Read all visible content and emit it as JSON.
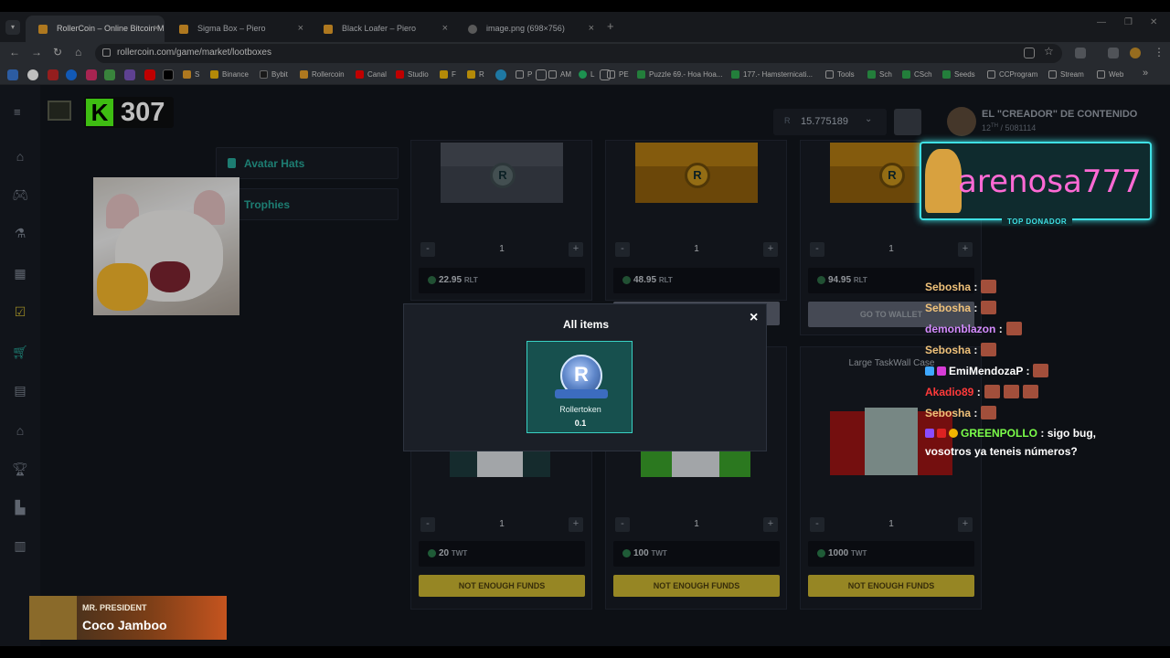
{
  "browser": {
    "tabs": [
      {
        "title": "RollerCoin – Online Bitcoin Mi",
        "active": true
      },
      {
        "title": "Sigma Box – Piero",
        "active": false
      },
      {
        "title": "Black Loafer – Piero",
        "active": false
      },
      {
        "title": "image.png (698×756)",
        "active": false
      }
    ],
    "url": "rollercoin.com/game/market/lootboxes",
    "bookmarks": [
      "S",
      "Binance",
      "Bybit",
      "Rollercoin",
      "Canal",
      "Studio",
      "F",
      "R",
      "P",
      "AM",
      "L",
      "PE",
      "Puzzle 69.- Hoa Hoa...",
      "177.- Hamsternicati...",
      "Tools",
      "Sch",
      "CSch",
      "Seeds",
      "CCProgram",
      "Stream",
      "Web"
    ]
  },
  "header": {
    "kick_count": "307",
    "balance_currency": "R",
    "balance": "15.775189",
    "username": "EL \"CREADOR\" DE CONTENIDO",
    "rank": "12",
    "rank_sup": "TH",
    "rank_total": "/ 5081114"
  },
  "side_menu": {
    "items": [
      "Avatar Hats",
      "Trophies"
    ]
  },
  "cards_top": [
    {
      "qty": "1",
      "price": "22.95",
      "unit": "RLT"
    },
    {
      "qty": "1",
      "price": "48.95",
      "unit": "RLT"
    },
    {
      "qty": "1",
      "price": "94.95",
      "unit": "RLT",
      "button": "GO TO WALLET"
    }
  ],
  "cards_bottom": [
    {
      "title": "",
      "qty": "1",
      "price": "20",
      "unit": "TWT",
      "button": "NOT ENOUGH FUNDS"
    },
    {
      "title": "",
      "qty": "1",
      "price": "100",
      "unit": "TWT",
      "button": "NOT ENOUGH FUNDS"
    },
    {
      "title": "Large TaskWall Case",
      "qty": "1",
      "price": "1000",
      "unit": "TWT",
      "button": "NOT ENOUGH FUNDS"
    }
  ],
  "modal": {
    "title": "All items",
    "close": "×",
    "item": {
      "name": "Rollertoken",
      "amount": "0.1",
      "symbol": "R"
    }
  },
  "donor": {
    "name": "arenosa777",
    "badge": "TOP DONADOR"
  },
  "chat": [
    {
      "user": "Sebosha",
      "color": "#f0c27a",
      "text": ":"
    },
    {
      "user": "Sebosha",
      "color": "#f0c27a",
      "text": ":"
    },
    {
      "user": "demonblazon",
      "color": "#d58cff",
      "text": ":"
    },
    {
      "user": "Sebosha",
      "color": "#f0c27a",
      "text": ":"
    },
    {
      "user": "EmiMendozaP",
      "color": "#ffffff",
      "text": ":"
    },
    {
      "user": "Akadio89",
      "color": "#ff3a3a",
      "text": ":"
    },
    {
      "user": "Sebosha",
      "color": "#f0c27a",
      "text": ":"
    },
    {
      "user": "GREENPOLLO",
      "color": "#7cff4a",
      "text": ": sigo bug,"
    },
    {
      "user": "",
      "color": "#ffffff",
      "text": "vosotros ya teneis números?"
    }
  ],
  "music": {
    "label": "MR. PRESIDENT",
    "song": "Coco Jamboo"
  }
}
